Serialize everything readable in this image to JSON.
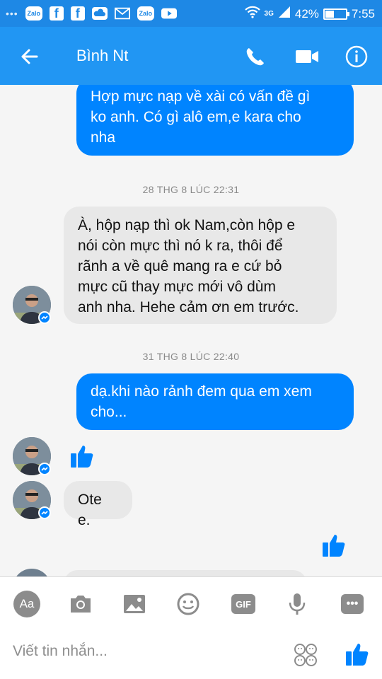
{
  "status_bar": {
    "notifications": [
      "Zalo",
      "f",
      "f",
      "Zalo"
    ],
    "network": "3G",
    "battery": "42%",
    "battery_level": 0.42,
    "time": "7:55"
  },
  "header": {
    "contact_name": "Bình Nt"
  },
  "messages": [
    {
      "side": "out",
      "text_lines": [
        "Hợp mực nạp về xài có vấn đề gì",
        "ko anh. Có gì alô em,e kara cho",
        "nha"
      ]
    },
    {
      "timestamp": "28 THG 8 LÚC 22:31"
    },
    {
      "side": "in",
      "text_lines": [
        "À, hộp nạp thì ok Nam,còn hộp e",
        "nói còn mực thì nó k ra, thôi để",
        "rãnh a về quê mang ra e cứ bỏ",
        "mực cũ thay mực mới vô dùm",
        "anh nha. Hehe cảm ơn em trước."
      ]
    },
    {
      "timestamp": "31 THG 8 LÚC 22:40"
    },
    {
      "side": "out",
      "text_lines": [
        "dạ.khi nào rảnh đem qua em xem",
        "cho..."
      ]
    },
    {
      "side": "in",
      "type": "like"
    },
    {
      "side": "in",
      "text_lines": [
        "Ote e."
      ]
    },
    {
      "side": "out",
      "type": "like"
    }
  ],
  "composer": {
    "aa_label": "Aa",
    "gif_label": "GIF",
    "placeholder": "Viết tin nhắn..."
  },
  "colors": {
    "status_bar": "#1e88e5",
    "app_bar": "#2196f3",
    "outgoing_bubble": "#0084ff",
    "incoming_bubble": "#e8e8e8"
  },
  "icons": [
    "back-arrow-icon",
    "phone-icon",
    "video-camera-icon",
    "info-icon",
    "camera-icon",
    "image-icon",
    "emoji-icon",
    "microphone-icon",
    "more-icon",
    "thumbs-up-icon"
  ]
}
